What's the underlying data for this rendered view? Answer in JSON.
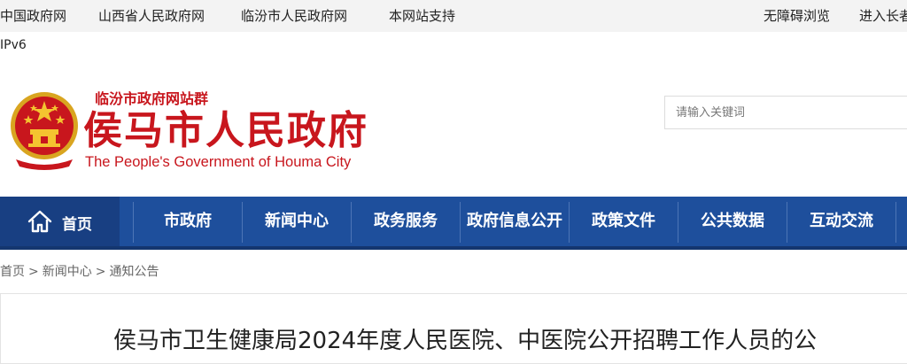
{
  "topbar": {
    "links": [
      "中国政府网",
      "山西省人民政府网",
      "临汾市人民政府网",
      "本网站支持"
    ],
    "accessibility": "无障碍浏览",
    "elder_mode": "进入长者"
  },
  "ipv6": "IPv6",
  "header": {
    "site_group": "临汾市政府网站群",
    "site_name": "侯马市人民政府",
    "site_name_en": "The People's Government of Houma City",
    "emblem_icon": "national-emblem-icon",
    "brand_color": "#c8161d"
  },
  "search": {
    "placeholder": "请输入关键词"
  },
  "nav": {
    "home_icon": "home-icon",
    "home": "首页",
    "items": [
      "市政府",
      "新闻中心",
      "政务服务",
      "政府信息公开",
      "政策文件",
      "公共数据",
      "互动交流"
    ],
    "color": "#1e4f9c"
  },
  "breadcrumb": {
    "items": [
      "首页",
      "新闻中心",
      "通知公告"
    ],
    "separator": ">"
  },
  "article": {
    "title": "侯马市卫生健康局2024年度人民医院、中医院公开招聘工作人员的公"
  }
}
